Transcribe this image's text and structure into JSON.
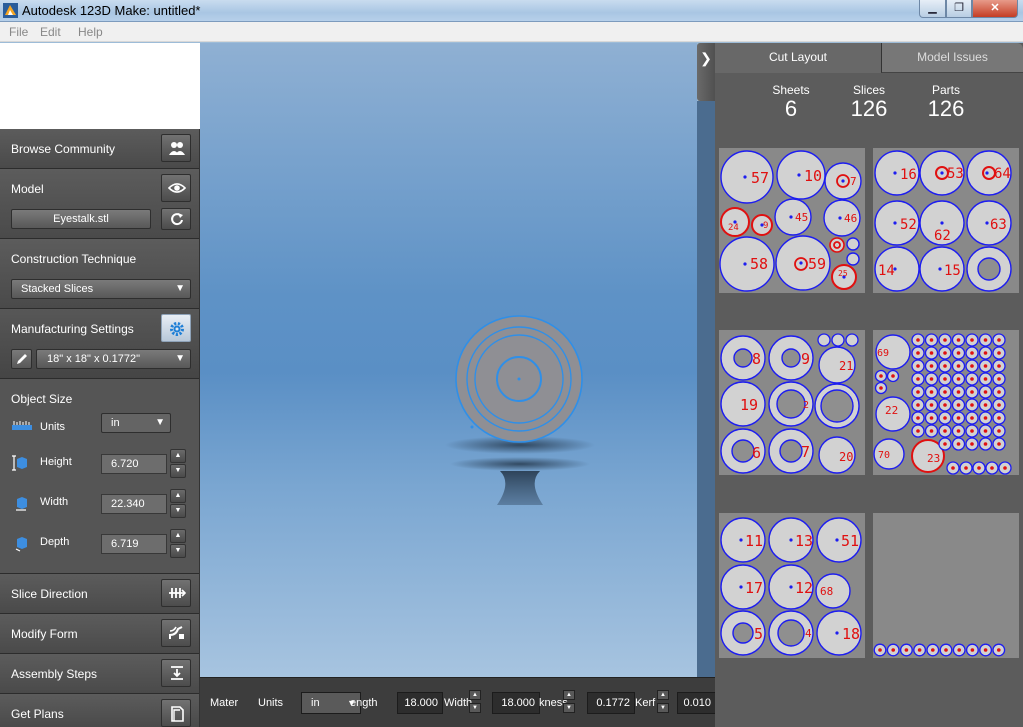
{
  "window": {
    "title": "Autodesk 123D Make: untitled*",
    "min": "▁",
    "max": "❐",
    "close": "✕"
  },
  "menu": [
    "File",
    "Edit",
    "Help"
  ],
  "sidebar": {
    "browse": {
      "label": "Browse Community"
    },
    "model": {
      "label": "Model",
      "file": "Eyestalk.stl"
    },
    "technique": {
      "label": "Construction Technique",
      "value": "Stacked Slices"
    },
    "manufacturing": {
      "label": "Manufacturing Settings",
      "value": "18\" x 18\" x 0.1772\""
    },
    "object_size": {
      "label": "Object Size",
      "units_label": "Units",
      "units_value": "in",
      "height_label": "Height",
      "height_value": "6.720",
      "width_label": "Width",
      "width_value": "22.340",
      "depth_label": "Depth",
      "depth_value": "6.719"
    },
    "slice_direction": "Slice Direction",
    "modify_form": "Modify Form",
    "assembly_steps": "Assembly Steps",
    "get_plans": "Get Plans"
  },
  "bottom_bar": {
    "material": "Mater",
    "units": "Units",
    "units_value": "in",
    "length_label": "ength",
    "length_value": "18.000",
    "width_label": "Width",
    "width_value": "18.000",
    "thickness_label": "kness",
    "thickness_value": "0.1772",
    "kerf_label": "Kerf",
    "kerf_value": "0.010"
  },
  "panel": {
    "collapse_glyph": "❯",
    "tabs": [
      "Cut Layout",
      "Model Issues"
    ],
    "stats": [
      {
        "label": "Sheets",
        "value": "6"
      },
      {
        "label": "Slices",
        "value": "126"
      },
      {
        "label": "Parts",
        "value": "126"
      }
    ]
  },
  "sheets": [
    {
      "labels": [
        "57",
        "10",
        "7",
        "24",
        "9",
        "45",
        "46",
        "58",
        "59",
        "25"
      ]
    },
    {
      "labels": [
        "16",
        "53",
        "64",
        "52",
        "62",
        "63",
        "14",
        "15"
      ]
    },
    {
      "labels": [
        "8",
        "9",
        "21",
        "19",
        "2",
        "6",
        "7",
        "20"
      ]
    },
    {
      "labels": [
        "69",
        "22",
        "70",
        "23"
      ]
    },
    {
      "labels": [
        "11",
        "13",
        "51",
        "17",
        "12",
        "68",
        "5",
        "4",
        "18"
      ]
    },
    {
      "labels": []
    }
  ],
  "colors": {
    "part_outline": "#1d1df0",
    "part_label": "#e01010",
    "selection": "#2f8fe8"
  }
}
